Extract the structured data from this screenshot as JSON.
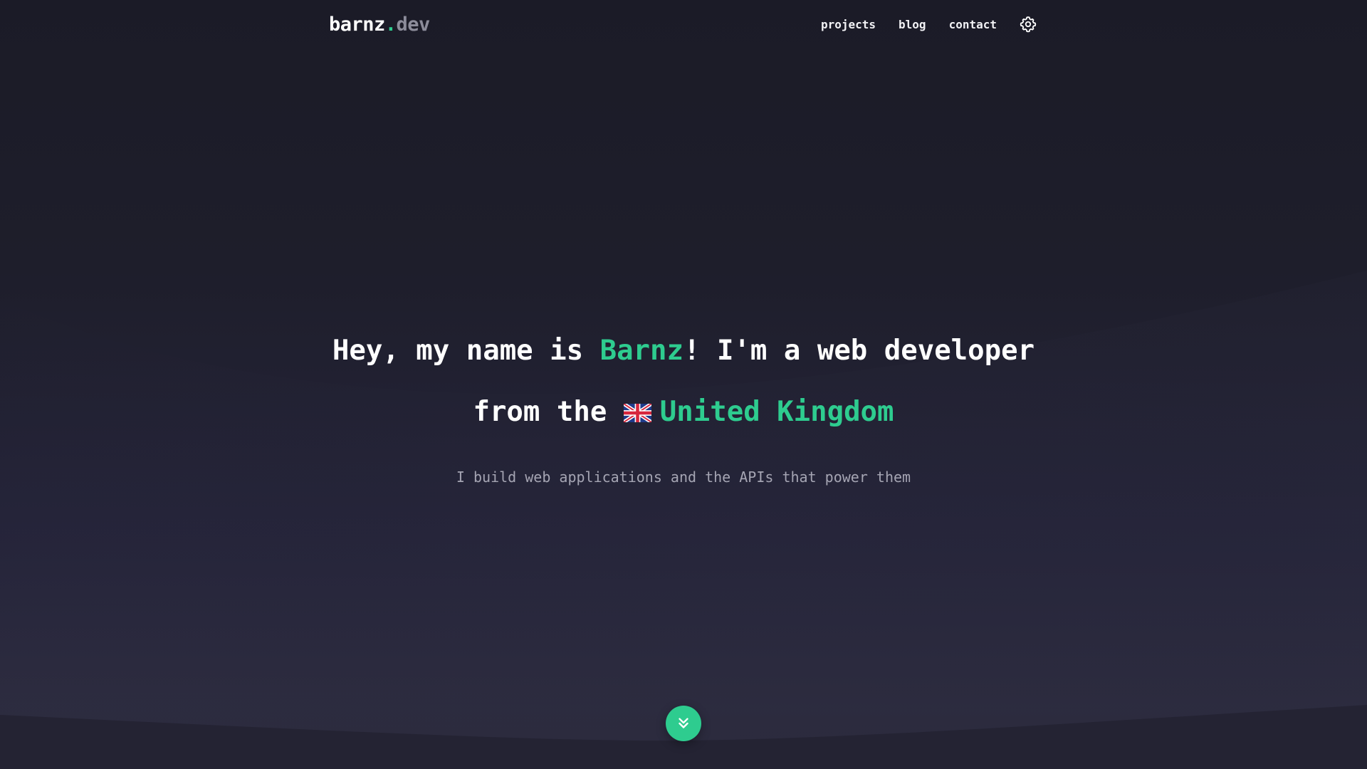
{
  "header": {
    "logo": {
      "name": "barnz",
      "dot": ".",
      "tld": "dev"
    },
    "nav": [
      {
        "label": "projects"
      },
      {
        "label": "blog"
      },
      {
        "label": "contact"
      }
    ],
    "settings_icon": "gear-icon"
  },
  "hero": {
    "line1": {
      "prefix": "Hey, my name is ",
      "name": "Barnz",
      "suffix": "! I'm a web developer"
    },
    "line2": {
      "prefix": "from the ",
      "flag_icon": "uk-flag-icon",
      "country": "United Kingdom"
    },
    "subtitle": "I build web applications and the APIs that power them"
  },
  "scroll_button": {
    "icon": "double-chevron-down-icon"
  },
  "colors": {
    "accent": "#2ecc8f",
    "background": "#1e1e2b",
    "muted_text": "#a5a5b3",
    "logo_tld": "#8c8c9a"
  }
}
